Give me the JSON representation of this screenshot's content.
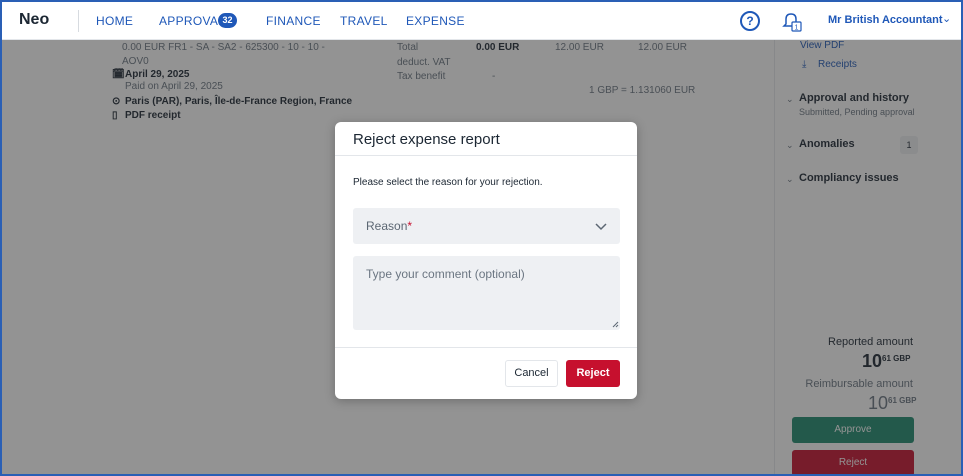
{
  "nav": {
    "brand": "Neo",
    "items": [
      {
        "label": "HOME"
      },
      {
        "label": "APPROVAL",
        "badge": "32"
      },
      {
        "label": "FINANCE"
      },
      {
        "label": "TRAVEL"
      },
      {
        "label": "EXPENSE"
      }
    ],
    "help_icon": "help-circle-icon",
    "notifications_icon": "bell-icon",
    "notifications_count": "1",
    "user_name": "Mr British Accountant"
  },
  "background": {
    "expense": {
      "line1": "0.00 EUR FR1 - SA - SA2 - 625300 - 10 - 10 -",
      "line2": "AOV0",
      "date": "April 29, 2025",
      "paid_on": "Paid on April 29, 2025",
      "location": "Paris (PAR), Paris, Île-de-France Region, France",
      "receipt": "PDF receipt"
    },
    "summary": {
      "total_label": "Total",
      "total_value": "0.00 EUR",
      "col3": "12.00 EUR",
      "col4": "12.00 EUR",
      "vat_label": "deduct. VAT",
      "tax_label": "Tax benefit",
      "tax_value": "-",
      "rate": "1 GBP = 1.131060 EUR"
    },
    "side": {
      "view_pdf": "View PDF",
      "receipts": "Receipts",
      "approval_title": "Approval and history",
      "approval_sub": "Submitted, Pending approval",
      "anomalies": "Anomalies",
      "anomalies_count": "1",
      "compliancy": "Compliancy issues",
      "reported_label": "Reported amount",
      "reported_int": "10",
      "reported_dec": "61 GBP",
      "reimbursable_label": "Reimbursable amount",
      "reimbursable_int": "10",
      "reimbursable_dec": "61 GBP",
      "approve_label": "Approve",
      "reject_label": "Reject"
    }
  },
  "modal": {
    "title": "Reject expense report",
    "instruction": "Please select the reason for your rejection.",
    "reason_label": "Reason",
    "reason_required": "*",
    "comment_placeholder": "Type your comment (optional)",
    "cancel_label": "Cancel",
    "reject_label": "Reject"
  }
}
